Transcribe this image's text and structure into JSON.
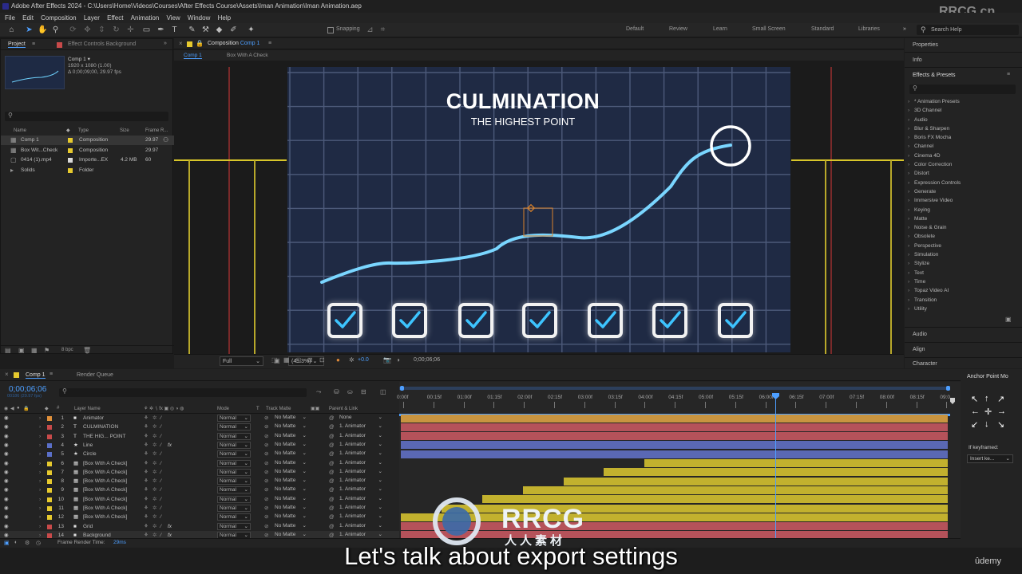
{
  "window_title": "Adobe After Effects 2024 - C:\\Users\\Home\\Videos\\Courses\\After Effects Course\\Assets\\Iman Animation\\Iman Animation.aep",
  "watermark_top_right": "RRCG.cn",
  "menu": [
    "File",
    "Edit",
    "Composition",
    "Layer",
    "Effect",
    "Animation",
    "View",
    "Window",
    "Help"
  ],
  "toolbar": {
    "snapping_label": "Snapping",
    "workspaces": [
      "Default",
      "Review",
      "Learn",
      "Small Screen",
      "Standard",
      "Libraries"
    ],
    "search_placeholder": "Search Help"
  },
  "project": {
    "tab_project": "Project",
    "tab_effect_controls": "Effect Controls Background",
    "comp_name": "Comp 1 ▾",
    "comp_res": "1920 x 1080 (1.00)",
    "comp_dur": "Δ 0;00;09;00, 29.97 fps",
    "columns": {
      "name": "Name",
      "type": "Type",
      "size": "Size",
      "frame_rate": "Frame R..."
    },
    "items": [
      {
        "name": "Comp 1",
        "type": "Composition",
        "size": "",
        "fps": "29.97",
        "color": "#e6c92e",
        "icon": "comp-icon",
        "selected": true
      },
      {
        "name": "Box Wit...Check",
        "type": "Composition",
        "size": "",
        "fps": "29.97",
        "color": "#e6c92e",
        "icon": "comp-icon",
        "selected": false
      },
      {
        "name": "0414 (1).mp4",
        "type": "Importe...EX",
        "size": "4.2 MB",
        "fps": "60",
        "color": "#d9d9d9",
        "icon": "footage-icon",
        "selected": false
      },
      {
        "name": "Solids",
        "type": "Folder",
        "size": "",
        "fps": "",
        "color": "#e6c92e",
        "icon": "folder-icon",
        "selected": false
      }
    ],
    "bpc": "8 bpc"
  },
  "composition": {
    "tab_label": "Composition",
    "tab_comp": "Comp 1",
    "breadcrumbs": [
      "Comp 1",
      "Box With A Check"
    ],
    "title": "CULMINATION",
    "subtitle": "THE HIGHEST POINT",
    "zoom": "(49.3%)",
    "resolution": "Full",
    "exposure": "+0.0",
    "timecode": "0;00;06;06"
  },
  "right_panels": {
    "properties": "Properties",
    "info": "Info",
    "effects_presets": "Effects & Presets",
    "effects": [
      "* Animation Presets",
      "3D Channel",
      "Audio",
      "Blur & Sharpen",
      "Boris FX Mocha",
      "Channel",
      "Cinema 4D",
      "Color Correction",
      "Distort",
      "Expression Controls",
      "Generate",
      "Immersive Video",
      "Keying",
      "Matte",
      "Noise & Grain",
      "Obsolete",
      "Perspective",
      "Simulation",
      "Stylize",
      "Text",
      "Time",
      "Topaz Video AI",
      "Transition",
      "Utility"
    ],
    "audio": "Audio",
    "align": "Align",
    "character": "Character"
  },
  "timeline": {
    "tab_comp": "Comp 1",
    "tab_render": "Render Queue",
    "timecode": "0;00;06;06",
    "frame_info": "00186 (29.97 fps)",
    "columns": {
      "layer_name": "Layer Name",
      "mode": "Mode",
      "t": "T",
      "track_matte": "Track Matte",
      "parent": "Parent & Link"
    },
    "ruler": [
      "0:00f",
      "00:15f",
      "01:00f",
      "01:15f",
      "02:00f",
      "02:15f",
      "03:00f",
      "03:15f",
      "04:00f",
      "04:15f",
      "05:00f",
      "05:15f",
      "06:00f",
      "06:15f",
      "07:00f",
      "07:15f",
      "08:00f",
      "08:15f",
      "09:0"
    ],
    "layers": [
      {
        "num": "1",
        "type": "solid",
        "name": "Animator",
        "mode": "Normal",
        "matte": "No Matte",
        "parent": "None",
        "color": "#e0903a",
        "bar_color": "#c89440",
        "start": 0.0,
        "fx": false
      },
      {
        "num": "2",
        "type": "T",
        "name": "CULMINATION",
        "mode": "Normal",
        "matte": "No Matte",
        "parent": "1. Animator",
        "color": "#c84a4a",
        "bar_color": "#b5525a",
        "start": 0.0,
        "fx": false
      },
      {
        "num": "3",
        "type": "T",
        "name": "THE HIG... POINT",
        "mode": "Normal",
        "matte": "No Matte",
        "parent": "1. Animator",
        "color": "#c84a4a",
        "bar_color": "#b5525a",
        "start": 0.0,
        "fx": false
      },
      {
        "num": "4",
        "type": "star",
        "name": "Line",
        "mode": "Normal",
        "matte": "No Matte",
        "parent": "1. Animator",
        "color": "#5a6fc8",
        "bar_color": "#5a68b4",
        "start": 0.0,
        "fx": true
      },
      {
        "num": "5",
        "type": "star",
        "name": "Circle",
        "mode": "Normal",
        "matte": "No Matte",
        "parent": "1. Animator",
        "color": "#5a6fc8",
        "bar_color": "#5a68b4",
        "start": 0.0,
        "fx": false
      },
      {
        "num": "6",
        "type": "comp",
        "name": "[Box With A Check]",
        "mode": "Normal",
        "matte": "No Matte",
        "parent": "1. Animator",
        "color": "#e6c92e",
        "bar_color": "#c2b12e",
        "start": 4.0,
        "fx": false
      },
      {
        "num": "7",
        "type": "comp",
        "name": "[Box With A Check]",
        "mode": "Normal",
        "matte": "No Matte",
        "parent": "1. Animator",
        "color": "#e6c92e",
        "bar_color": "#c2b12e",
        "start": 3.33,
        "fx": false
      },
      {
        "num": "8",
        "type": "comp",
        "name": "[Box With A Check]",
        "mode": "Normal",
        "matte": "No Matte",
        "parent": "1. Animator",
        "color": "#e6c92e",
        "bar_color": "#c2b12e",
        "start": 2.67,
        "fx": false
      },
      {
        "num": "9",
        "type": "comp",
        "name": "[Box With A Check]",
        "mode": "Normal",
        "matte": "No Matte",
        "parent": "1. Animator",
        "color": "#e6c92e",
        "bar_color": "#c2b12e",
        "start": 2.0,
        "fx": false
      },
      {
        "num": "10",
        "type": "comp",
        "name": "[Box With A Check]",
        "mode": "Normal",
        "matte": "No Matte",
        "parent": "1. Animator",
        "color": "#e6c92e",
        "bar_color": "#c2b12e",
        "start": 1.33,
        "fx": false
      },
      {
        "num": "11",
        "type": "comp",
        "name": "[Box With A Check]",
        "mode": "Normal",
        "matte": "No Matte",
        "parent": "1. Animator",
        "color": "#e6c92e",
        "bar_color": "#c2b12e",
        "start": 0.67,
        "fx": false
      },
      {
        "num": "12",
        "type": "comp",
        "name": "[Box With A Check]",
        "mode": "Normal",
        "matte": "No Matte",
        "parent": "1. Animator",
        "color": "#e6c92e",
        "bar_color": "#c2b12e",
        "start": 0.0,
        "fx": false
      },
      {
        "num": "13",
        "type": "solid",
        "name": "Grid",
        "mode": "Normal",
        "matte": "No Matte",
        "parent": "1. Animator",
        "color": "#c84a4a",
        "bar_color": "#b5525a",
        "start": 0.0,
        "fx": true
      },
      {
        "num": "14",
        "type": "solid",
        "name": "Background",
        "mode": "Normal",
        "matte": "No Matte",
        "parent": "1. Animator",
        "color": "#c84a4a",
        "bar_color": "#b5525a",
        "start": 0.0,
        "fx": true
      }
    ],
    "render_time_label": "Frame Render Time:",
    "render_time": "29ms"
  },
  "anchor_panel": {
    "title": "Anchor Point Mo",
    "if_keyframed": "If keyframed:",
    "insert_option": "Insert ke..."
  },
  "overlay": {
    "subtitle": "Let's talk about export settings",
    "logo_text": "RRCG",
    "logo_sub": "人人素材",
    "udemy": "ûdemy"
  }
}
